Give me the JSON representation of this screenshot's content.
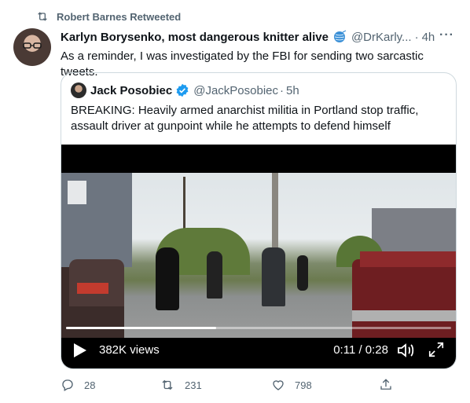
{
  "retweet": {
    "text": "Robert Barnes Retweeted"
  },
  "tweet": {
    "author_name": "Karlyn Borysenko, most dangerous knitter alive",
    "handle": "@DrKarly...",
    "separator": "·",
    "time": "4h",
    "more": "···",
    "text": "As a reminder, I was investigated by the FBI for sending two sarcastic tweets."
  },
  "quote": {
    "author_name": "Jack Posobiec",
    "handle": "@JackPosobiec",
    "separator": "·",
    "time": "5h",
    "text": "BREAKING: Heavily armed anarchist militia in Portland stop traffic, assault driver at gunpoint while he attempts to defend himself"
  },
  "video": {
    "views": "382K views",
    "timecode": "0:11 / 0:28",
    "progress": 0.39
  },
  "actions": {
    "reply_count": "28",
    "retweet_count": "231",
    "like_count": "798"
  },
  "colors": {
    "secondary_text": "#536471",
    "verified_blue": "#1d9bf0",
    "border": "#cfd9de"
  }
}
